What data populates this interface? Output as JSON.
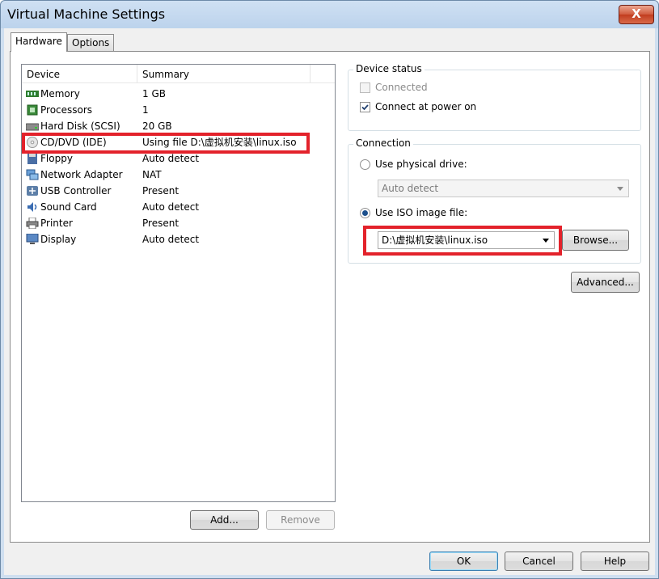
{
  "window": {
    "title": "Virtual Machine Settings",
    "close_glyph": "X"
  },
  "tabs": [
    {
      "label": "Hardware"
    },
    {
      "label": "Options"
    }
  ],
  "device_list": {
    "columns": {
      "device": "Device",
      "summary": "Summary"
    },
    "rows": [
      {
        "device": "Memory",
        "summary": "1 GB",
        "icon": "memory-icon"
      },
      {
        "device": "Processors",
        "summary": "1",
        "icon": "processor-icon"
      },
      {
        "device": "Hard Disk (SCSI)",
        "summary": "20 GB",
        "icon": "hard-disk-icon"
      },
      {
        "device": "CD/DVD (IDE)",
        "summary": "Using file D:\\虚拟机安装\\linux.iso",
        "icon": "cd-dvd-icon",
        "selected": true
      },
      {
        "device": "Floppy",
        "summary": "Auto detect",
        "icon": "floppy-icon"
      },
      {
        "device": "Network Adapter",
        "summary": "NAT",
        "icon": "network-adapter-icon"
      },
      {
        "device": "USB Controller",
        "summary": "Present",
        "icon": "usb-icon"
      },
      {
        "device": "Sound Card",
        "summary": "Auto detect",
        "icon": "sound-card-icon"
      },
      {
        "device": "Printer",
        "summary": "Present",
        "icon": "printer-icon"
      },
      {
        "device": "Display",
        "summary": "Auto detect",
        "icon": "display-icon"
      }
    ]
  },
  "list_buttons": {
    "add": "Add...",
    "remove": "Remove"
  },
  "device_status": {
    "label": "Device status",
    "connected": {
      "label": "Connected",
      "checked": false,
      "enabled": false
    },
    "connect_at_power_on": {
      "label": "Connect at power on",
      "checked": true,
      "enabled": true
    }
  },
  "connection": {
    "label": "Connection",
    "physical_drive": {
      "label": "Use physical drive:",
      "selected": false,
      "value": "Auto detect"
    },
    "iso_image": {
      "label": "Use ISO image file:",
      "selected": true,
      "value": "D:\\虚拟机安装\\linux.iso"
    },
    "browse_label": "Browse..."
  },
  "advanced_label": "Advanced...",
  "dialog_buttons": {
    "ok": "OK",
    "cancel": "Cancel",
    "help": "Help"
  },
  "colors": {
    "highlight_box": "#e3222b",
    "title_bar": "#bcd3ec"
  }
}
